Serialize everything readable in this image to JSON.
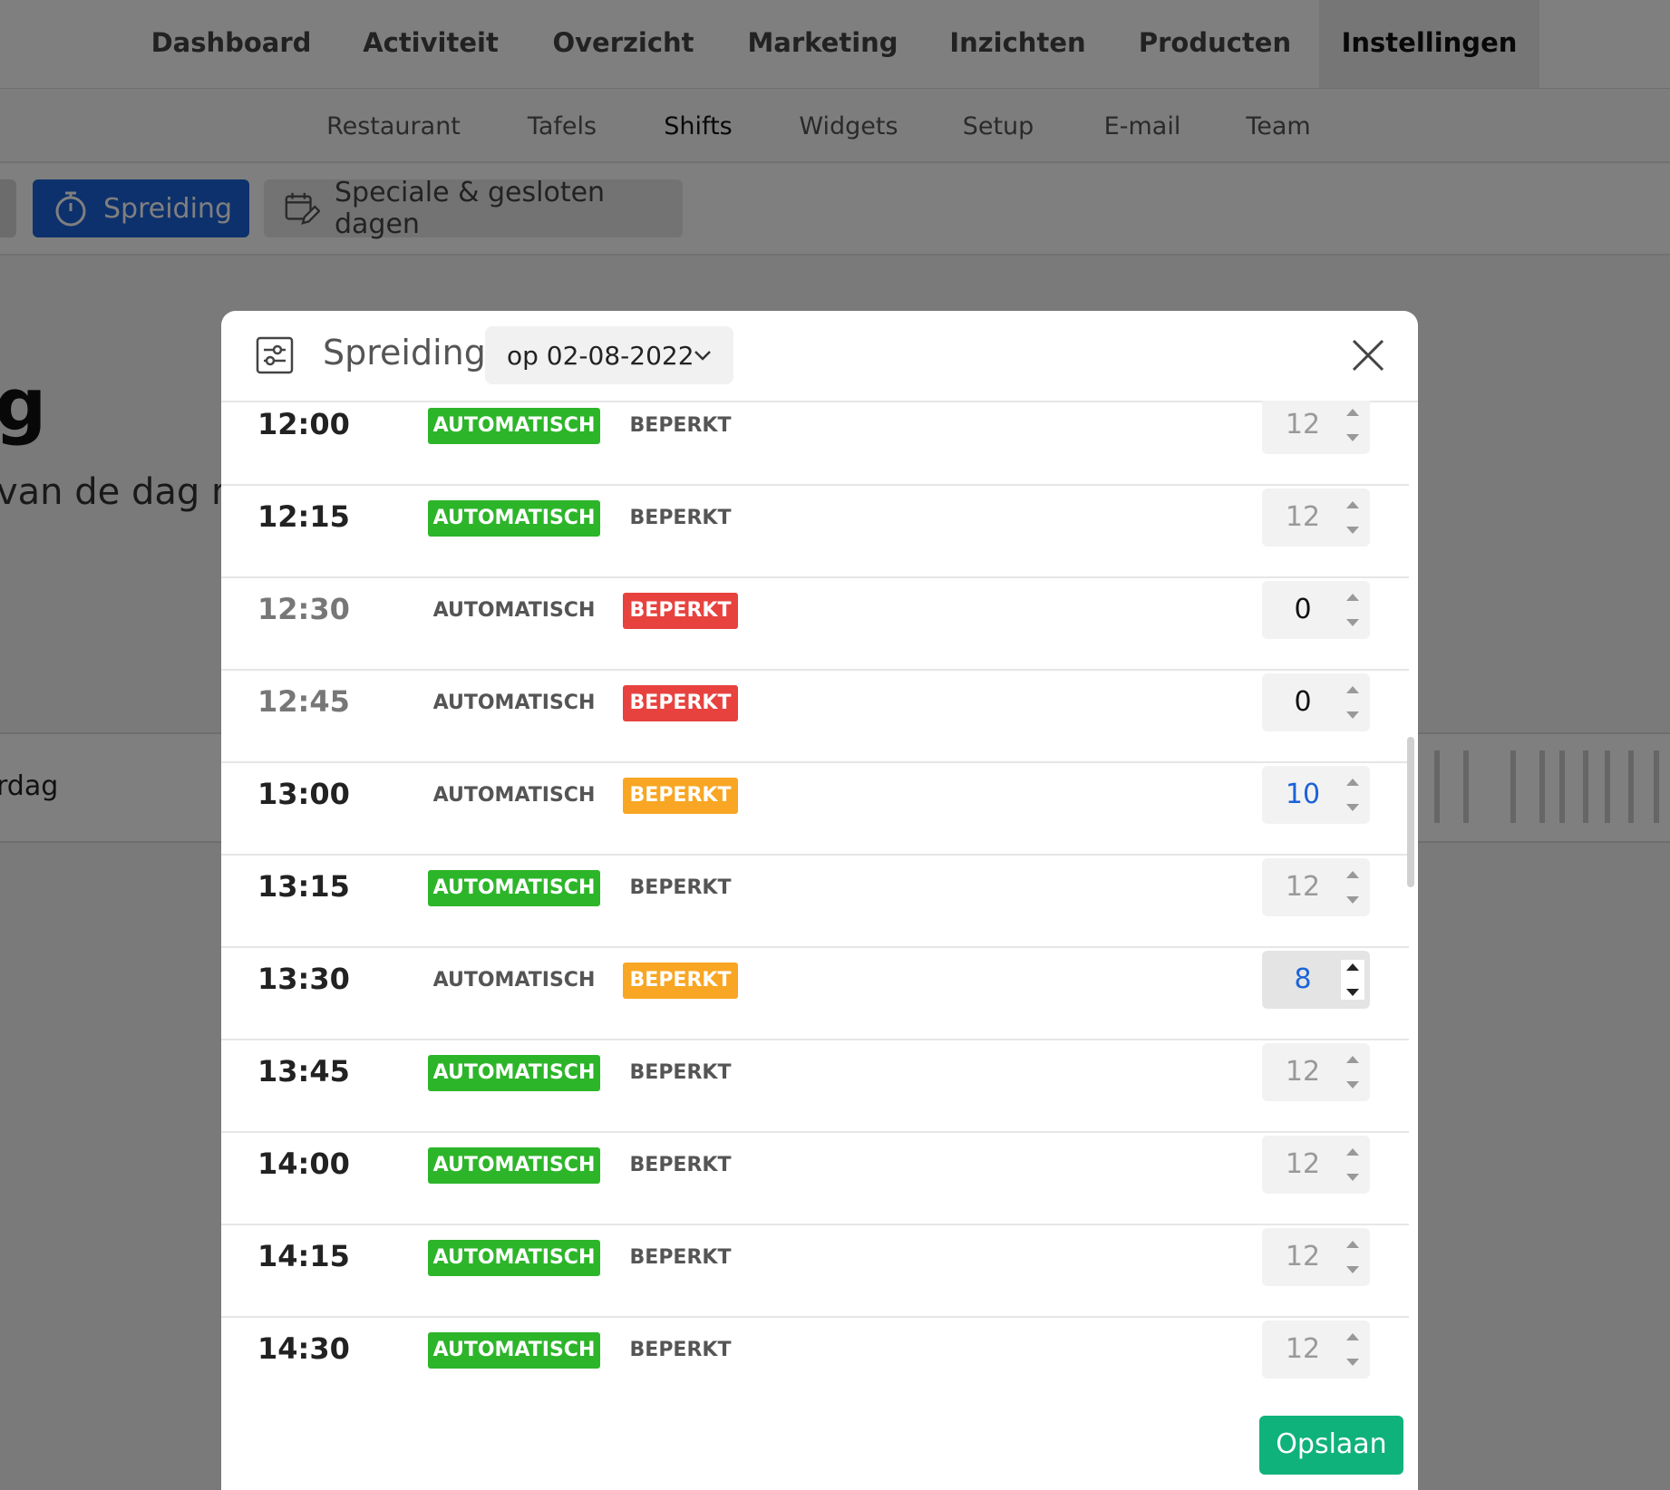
{
  "topnav": {
    "items": [
      {
        "label": "Dashboard"
      },
      {
        "label": "Activiteit"
      },
      {
        "label": "Overzicht"
      },
      {
        "label": "Marketing"
      },
      {
        "label": "Inzichten"
      },
      {
        "label": "Producten"
      },
      {
        "label": "Instellingen",
        "active": true
      }
    ]
  },
  "subnav": {
    "items": [
      {
        "label": "Restaurant"
      },
      {
        "label": "Tafels"
      },
      {
        "label": "Shifts",
        "active": true
      },
      {
        "label": "Widgets"
      },
      {
        "label": "Setup"
      },
      {
        "label": "E-mail"
      },
      {
        "label": "Team"
      }
    ]
  },
  "toolbar": {
    "spreiding_label": "Spreiding",
    "speciale_label": "Speciale & gesloten dagen"
  },
  "background": {
    "heading_fragment": "g",
    "subtext_fragment": "van de dag m",
    "row_label_fragment": "rdag"
  },
  "modal": {
    "title": "Spreiding",
    "date_selected": "op 02-08-2022",
    "save_label": "Opslaan",
    "auto_label": "AUTOMATISCH",
    "limited_label": "BEPERKT",
    "rows": [
      {
        "time": "12:00",
        "mode": "auto",
        "value": "12"
      },
      {
        "time": "12:15",
        "mode": "auto",
        "value": "12"
      },
      {
        "time": "12:30",
        "mode": "limited-red",
        "value": "0"
      },
      {
        "time": "12:45",
        "mode": "limited-red",
        "value": "0"
      },
      {
        "time": "13:00",
        "mode": "limited-orange",
        "value": "10"
      },
      {
        "time": "13:15",
        "mode": "auto",
        "value": "12"
      },
      {
        "time": "13:30",
        "mode": "limited-orange",
        "value": "8",
        "focused": true
      },
      {
        "time": "13:45",
        "mode": "auto",
        "value": "12"
      },
      {
        "time": "14:00",
        "mode": "auto",
        "value": "12"
      },
      {
        "time": "14:15",
        "mode": "auto",
        "value": "12"
      },
      {
        "time": "14:30",
        "mode": "auto",
        "value": "12"
      }
    ]
  },
  "colors": {
    "primary_blue": "#1a63d8",
    "auto_green": "#2db52a",
    "limited_red": "#e8423f",
    "limited_orange": "#f8a623",
    "save_green": "#10b27c"
  },
  "icons": {
    "spreiding": "stopwatch-icon",
    "speciale": "calendar-edit-icon",
    "modal": "sliders-icon",
    "date_dropdown": "chevron-down-icon",
    "close": "close-icon"
  }
}
